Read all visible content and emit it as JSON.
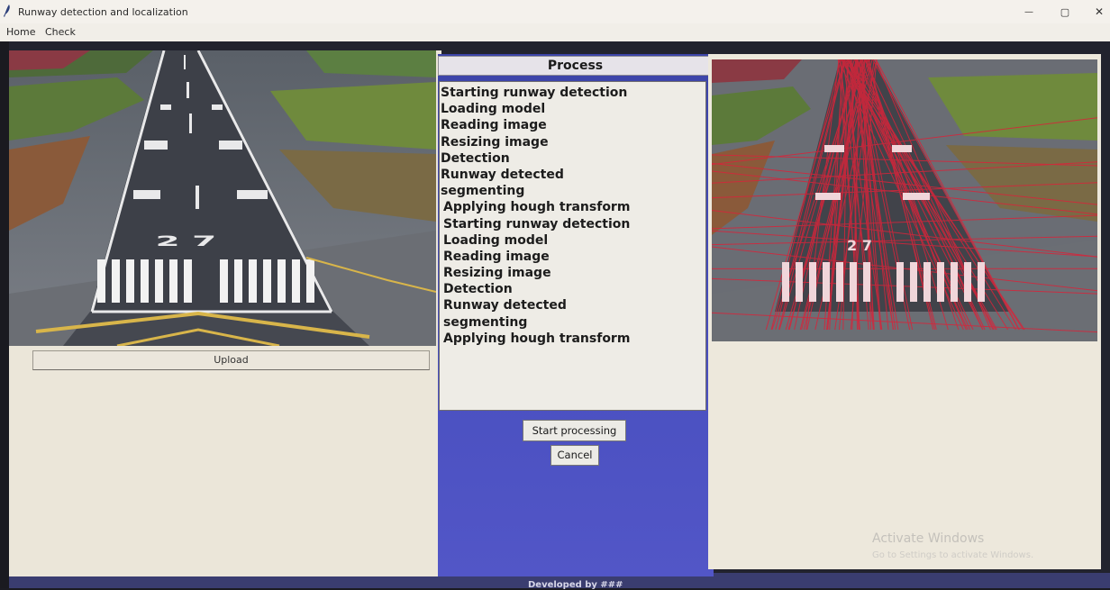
{
  "window": {
    "title": "Runway detection and localization",
    "minimize_glyph": "—",
    "restore_glyph": "▢",
    "close_glyph": "✕"
  },
  "menu": {
    "items": [
      "Home",
      "Check"
    ]
  },
  "left_panel": {
    "image_name": "runway-input-photo",
    "upload_label": "Upload"
  },
  "process": {
    "header": "Process",
    "log": [
      "Starting runway detection",
      "Loading model",
      "Reading image",
      "Resizing image",
      "Detection",
      "Runway detected",
      "segmenting",
      "Applying hough transform",
      "Starting runway detection",
      "Loading model",
      "Reading image",
      "Resizing image",
      "Detection",
      "Runway detected",
      "segmenting",
      "Applying hough transform"
    ],
    "start_label": "Start processing",
    "cancel_label": "Cancel"
  },
  "right_panel": {
    "image_name": "runway-hough-lines-output"
  },
  "watermark": {
    "title": "Activate Windows",
    "subtitle": "Go to Settings to activate Windows."
  },
  "footer": {
    "text": "Developed by ###"
  },
  "colors": {
    "panel_bg": "#ebe6d9",
    "middle_bg": "#4a50c0",
    "hough_red": "#d8243a"
  }
}
